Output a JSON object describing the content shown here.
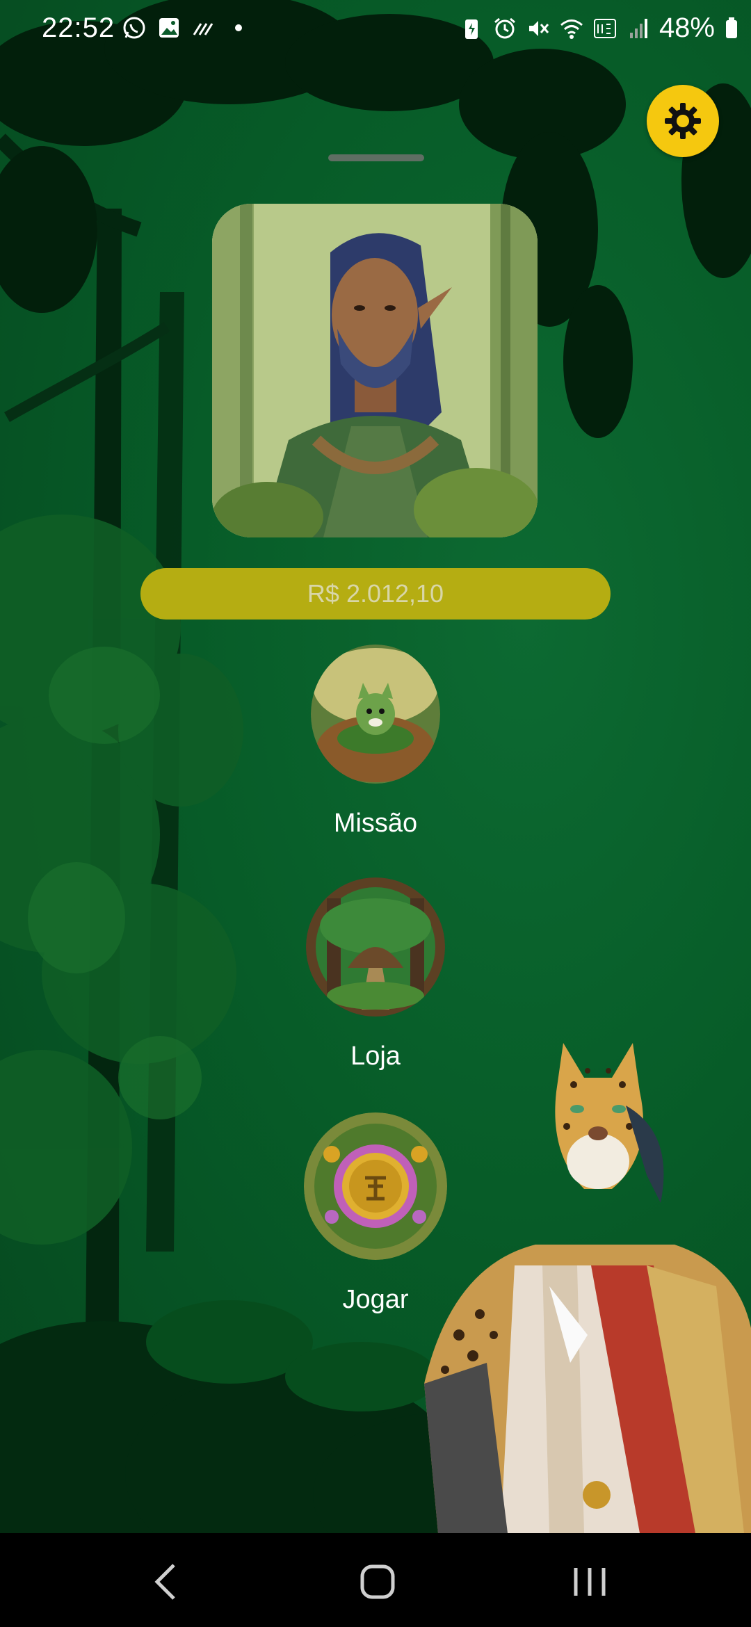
{
  "status_bar": {
    "time": "22:52",
    "left_icons": [
      "whatsapp-icon",
      "gallery-icon",
      "signal-lines-icon",
      "dot-icon"
    ],
    "right_icons": [
      "battery-saver-icon",
      "alarm-icon",
      "mute-icon",
      "wifi-icon",
      "volte-icon",
      "cell-signal-icon"
    ],
    "battery_text": "48%"
  },
  "settings": {
    "icon": "gear-icon",
    "color": "#f5c80f"
  },
  "balance": {
    "text": "R$ 2.012,10",
    "color": "#b5ad12"
  },
  "menu": {
    "items": [
      {
        "label": "Missão",
        "icon": "fox-forest-icon"
      },
      {
        "label": "Loja",
        "icon": "forest-hut-icon"
      },
      {
        "label": "Jogar",
        "icon": "coin-wreath-icon"
      }
    ]
  },
  "nav": {
    "back": "back-icon",
    "home": "home-icon",
    "recents": "recents-icon"
  },
  "colors": {
    "background": "#075c28",
    "accent": "#f5c80f"
  }
}
